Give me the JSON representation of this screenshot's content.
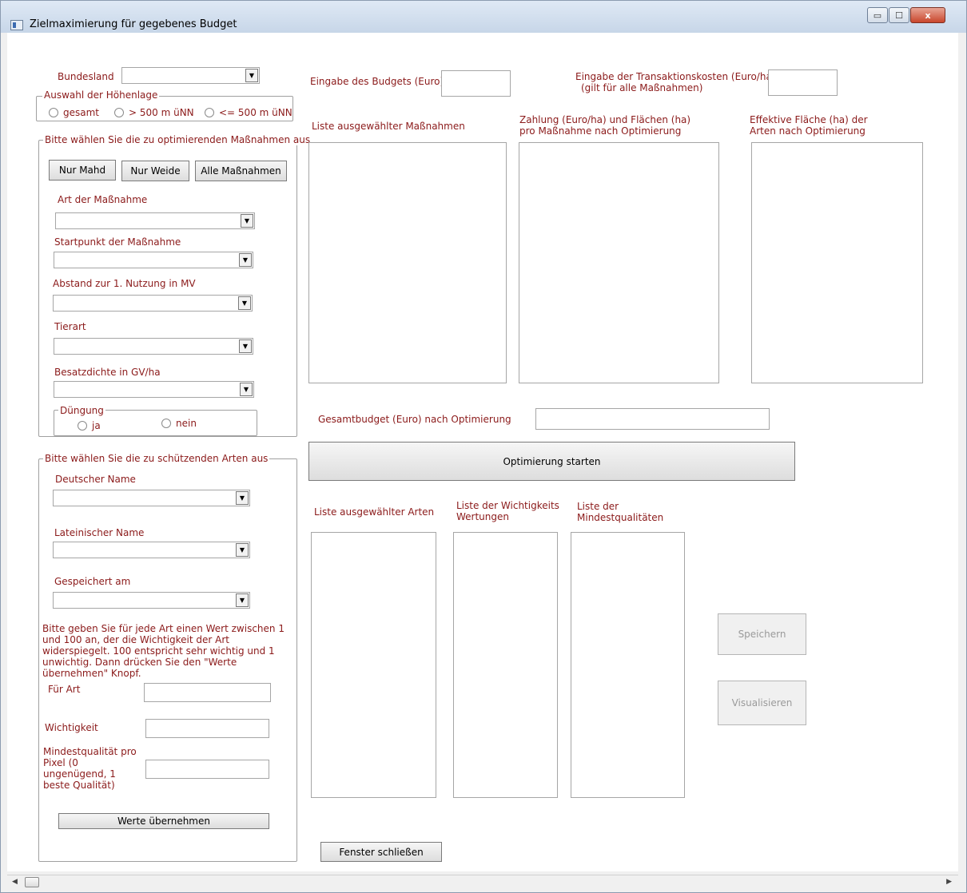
{
  "window": {
    "title": "Zielmaximierung für gegebenes Budget",
    "minimize_glyph": "▭",
    "maximize_glyph": "☐",
    "close_glyph": "x"
  },
  "left": {
    "bundesland_label": "Bundesland",
    "bundesland_value": "",
    "hoehenlage": {
      "group_label": "Auswahl der Höhenlage",
      "options": [
        "gesamt",
        "> 500 m üNN",
        "<= 500 m üNN"
      ]
    },
    "massnahmen": {
      "group_label": "Bitte wählen Sie die zu optimierenden Maßnahmen aus",
      "buttons": [
        "Nur Mahd",
        "Nur Weide",
        "Alle Maßnahmen"
      ],
      "art_label": "Art der Maßnahme",
      "startpunkt_label": "Startpunkt der Maßnahme",
      "abstand_label": "Abstand zur 1. Nutzung in MV",
      "tierart_label": "Tierart",
      "besatz_label": "Besatzdichte in GV/ha",
      "duengung": {
        "group_label": "Düngung",
        "options": [
          "ja",
          "nein"
        ]
      }
    },
    "arten": {
      "group_label": "Bitte wählen Sie die zu schützenden Arten aus",
      "deutscher_label": "Deutscher Name",
      "lateinischer_label": "Lateinischer Name",
      "gespeichert_label": "Gespeichert am",
      "instructions": "Bitte geben Sie für jede Art einen Wert zwischen 1 und 100 an, der die Wichtigkeit der Art widerspiegelt. 100 entspricht sehr wichtig und 1 unwichtig. Dann drücken Sie den \"Werte übernehmen\" Knopf.",
      "fuer_art_label": "Für Art",
      "wichtigkeit_label": "Wichtigkeit",
      "mindest_label": "Mindestqualität pro Pixel (0 ungenügend, 1 beste Qualität)",
      "uebernehmen_button": "Werte übernehmen"
    }
  },
  "main": {
    "budget_label": "Eingabe des Budgets (Euro)",
    "transaktion_label_1": "Eingabe der Transaktionskosten (Euro/ha)",
    "transaktion_label_2": "(gilt für alle Maßnahmen)",
    "liste_massnahmen_label": "Liste ausgewählter Maßnahmen",
    "zahlung_label_1": "Zahlung (Euro/ha) und Flächen (ha)",
    "zahlung_label_2": "pro Maßnahme nach Optimierung",
    "effektiv_label_1": "Effektive Fläche (ha) der",
    "effektiv_label_2": "Arten nach Optimierung",
    "gesamtbudget_label": "Gesamtbudget (Euro) nach Optimierung",
    "optimierung_button": "Optimierung starten",
    "liste_arten_label": "Liste ausgewählter Arten",
    "wichtigkeits_label_1": "Liste  der Wichtigkeits",
    "wichtigkeits_label_2": "Wertungen",
    "mindest_label_1": "Liste der",
    "mindest_label_2": "Mindestqualitäten",
    "speichern_button": "Speichern",
    "visualisieren_button": "Visualisieren",
    "schliessen_button": "Fenster schließen"
  },
  "scrollbar": {
    "left_arrow": "◀",
    "right_arrow": "▶"
  }
}
